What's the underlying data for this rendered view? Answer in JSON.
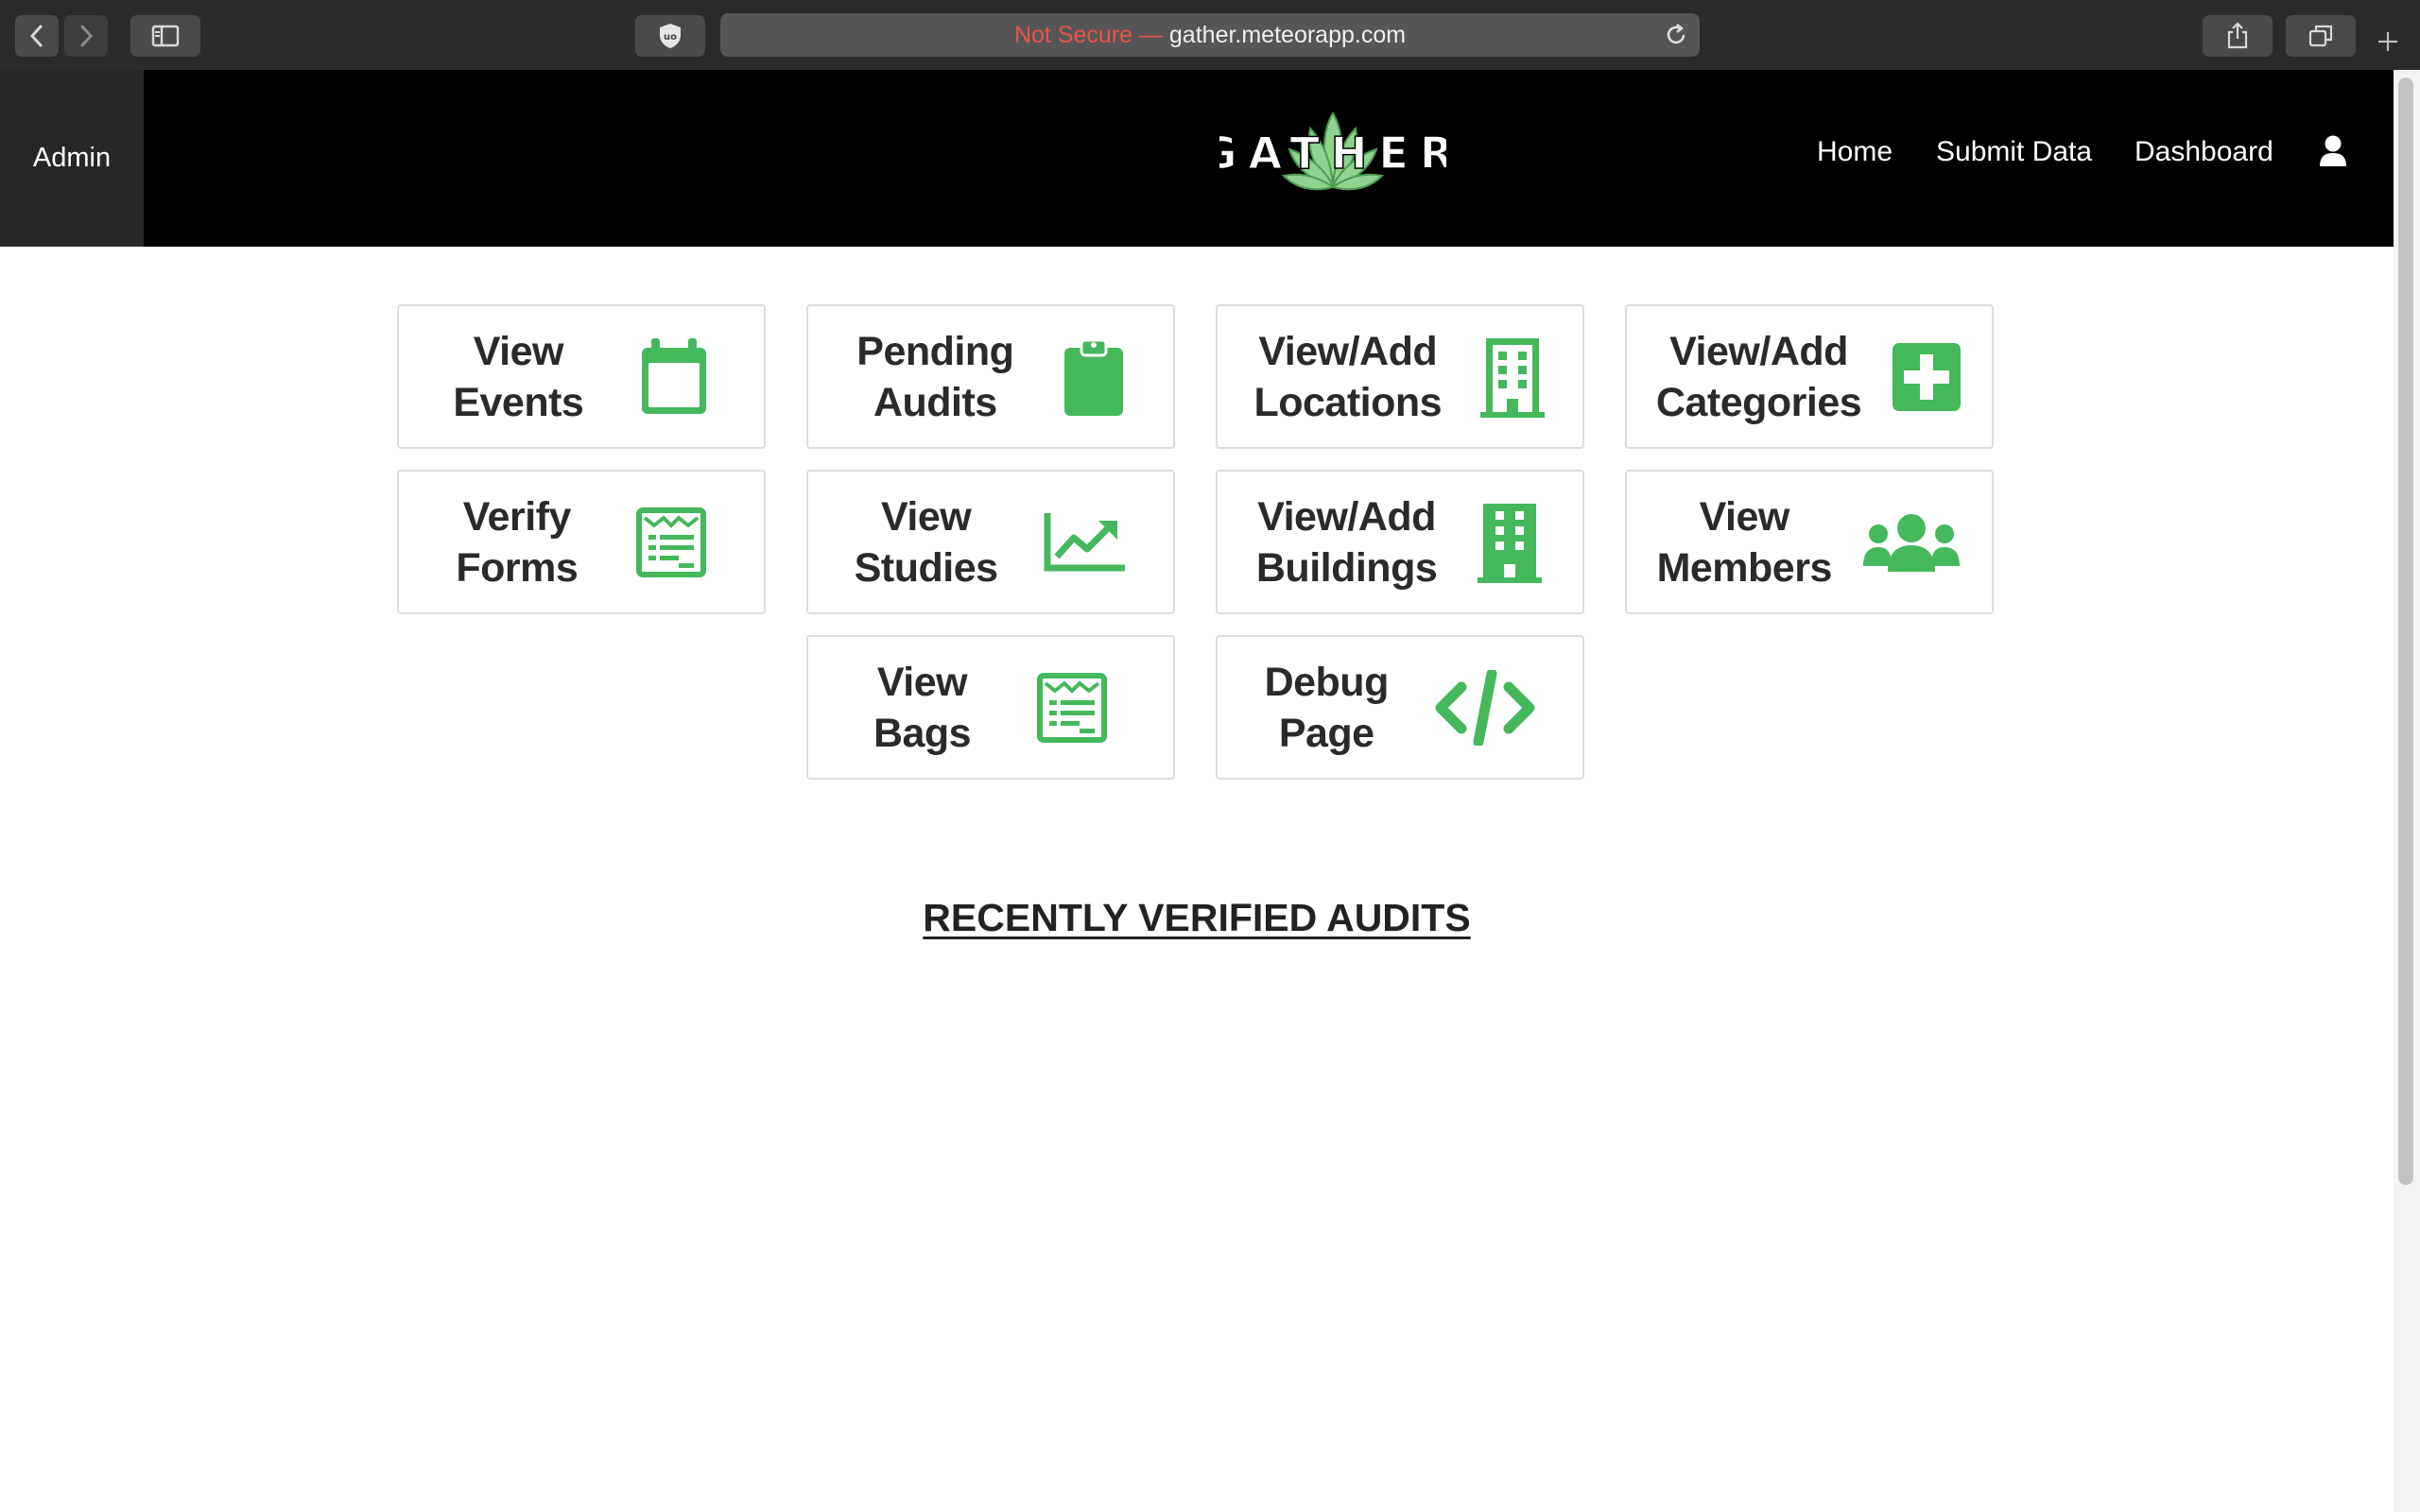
{
  "browser": {
    "not_secure": "Not Secure —",
    "url": "gather.meteorapp.com"
  },
  "header": {
    "admin_label": "Admin",
    "logo_text": "GATHER",
    "nav": {
      "home": "Home",
      "submit": "Submit Data",
      "dashboard": "Dashboard"
    }
  },
  "colors": {
    "accent": "#45b85c",
    "header_bg": "#000000"
  },
  "cards": [
    {
      "line1": "View",
      "line2": "Events",
      "icon": "calendar-icon"
    },
    {
      "line1": "Pending",
      "line2": "Audits",
      "icon": "clipboard-icon"
    },
    {
      "line1": "View/Add",
      "line2": "Locations",
      "icon": "building-icon"
    },
    {
      "line1": "View/Add",
      "line2": "Categories",
      "icon": "plus-square-icon"
    },
    {
      "line1": "Verify",
      "line2": "Forms",
      "icon": "form-icon"
    },
    {
      "line1": "View",
      "line2": "Studies",
      "icon": "chart-line-icon"
    },
    {
      "line1": "View/Add",
      "line2": "Buildings",
      "icon": "building-icon"
    },
    {
      "line1": "View",
      "line2": "Members",
      "icon": "users-icon"
    },
    {
      "line1": "View",
      "line2": "Bags",
      "icon": "form-icon"
    },
    {
      "line1": "Debug",
      "line2": "Page",
      "icon": "code-icon"
    }
  ],
  "recent_heading": "RECENTLY VERIFIED AUDITS"
}
